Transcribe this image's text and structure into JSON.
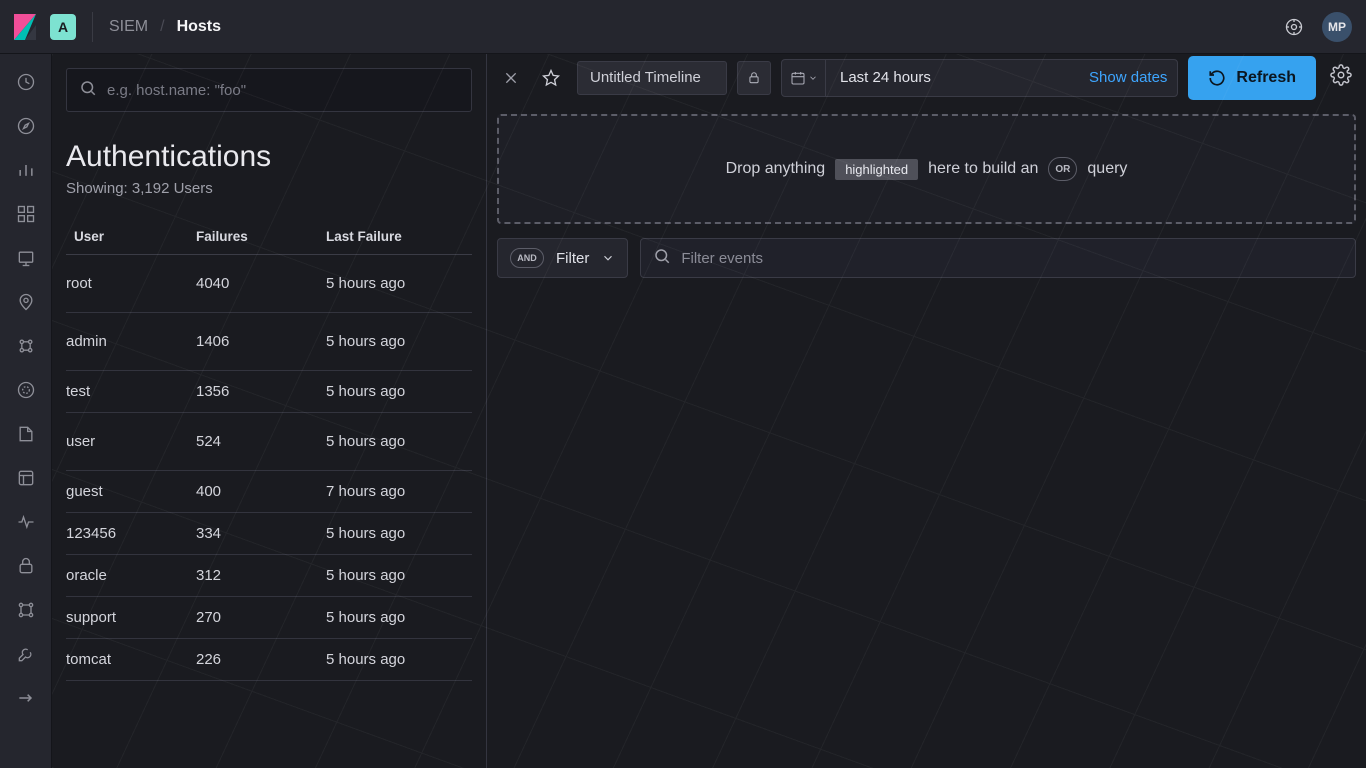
{
  "header": {
    "space_badge": "A",
    "breadcrumbs": {
      "app": "SIEM",
      "page": "Hosts"
    },
    "avatar_initials": "MP"
  },
  "rail": {
    "items": [
      "recent-icon",
      "compass-icon",
      "visualize-icon",
      "dashboard-icon",
      "canvas-icon",
      "maps-icon",
      "ml-icon",
      "infra-icon",
      "logs-icon",
      "apm-icon",
      "uptime-icon",
      "siem-icon",
      "devtools-icon",
      "management-icon"
    ]
  },
  "hosts": {
    "search": {
      "placeholder": "e.g. host.name: \"foo\""
    },
    "auth": {
      "title": "Authentications",
      "subtitle": "Showing: 3,192 Users",
      "columns": {
        "user": "User",
        "failures": "Failures",
        "last": "Last Failure"
      },
      "rows": [
        {
          "user": "root",
          "failures": "4040",
          "last": "5 hours ago",
          "tall": true
        },
        {
          "user": "admin",
          "failures": "1406",
          "last": "5 hours ago",
          "tall": true
        },
        {
          "user": "test",
          "failures": "1356",
          "last": "5 hours ago"
        },
        {
          "user": "user",
          "failures": "524",
          "last": "5 hours ago",
          "tall": true
        },
        {
          "user": "guest",
          "failures": "400",
          "last": "7 hours ago"
        },
        {
          "user": "123456",
          "failures": "334",
          "last": "5 hours ago"
        },
        {
          "user": "oracle",
          "failures": "312",
          "last": "5 hours ago"
        },
        {
          "user": "support",
          "failures": "270",
          "last": "5 hours ago"
        },
        {
          "user": "tomcat",
          "failures": "226",
          "last": "5 hours ago"
        }
      ]
    }
  },
  "timeline": {
    "title": "Untitled Timeline",
    "date_range": "Last 24 hours",
    "show_dates": "Show dates",
    "refresh": "Refresh",
    "drop": {
      "pre": "Drop anything",
      "highlight": "highlighted",
      "mid": "here to build an",
      "or": "OR",
      "post": "query"
    },
    "filter": {
      "and": "AND",
      "label": "Filter",
      "events_placeholder": "Filter events"
    }
  }
}
